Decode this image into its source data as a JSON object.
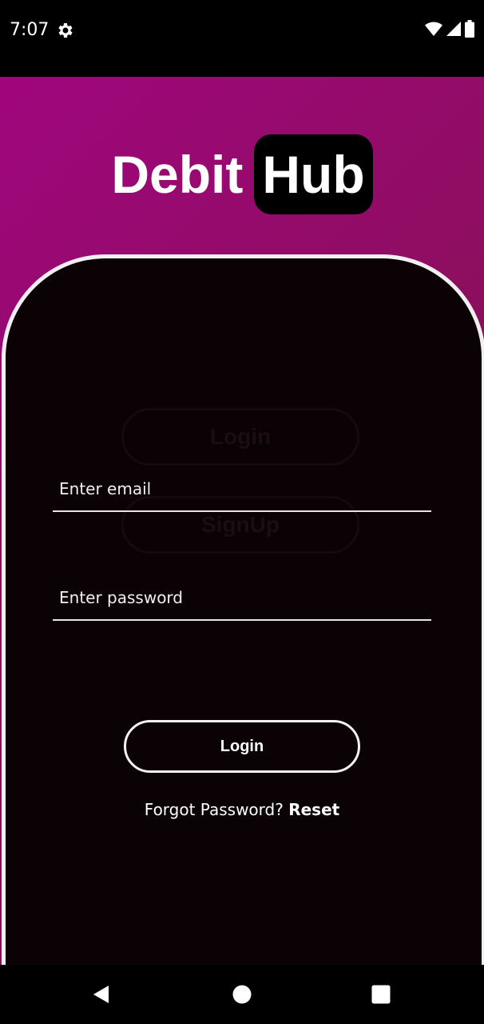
{
  "status_bar": {
    "time": "7:07",
    "icons": [
      "settings-icon",
      "wifi-icon",
      "signal-icon",
      "battery-icon"
    ]
  },
  "logo": {
    "part1": "Debit",
    "part2": "Hub"
  },
  "ghost_buttons": {
    "login_label": "Login",
    "signup_label": "SignUp"
  },
  "form": {
    "email_placeholder": "Enter email",
    "email_value": "",
    "password_placeholder": "Enter password",
    "password_value": ""
  },
  "login_button": {
    "label": "Login"
  },
  "forgot": {
    "prefix": "Forgot Password? ",
    "link": "Reset"
  },
  "nav_bar": {
    "icons": [
      "back-icon",
      "home-icon",
      "recents-icon"
    ]
  },
  "colors": {
    "gradient_start": "#a0067d",
    "gradient_end": "#801543",
    "card_bg": "#0a0205",
    "card_border": "#f3eef2"
  }
}
